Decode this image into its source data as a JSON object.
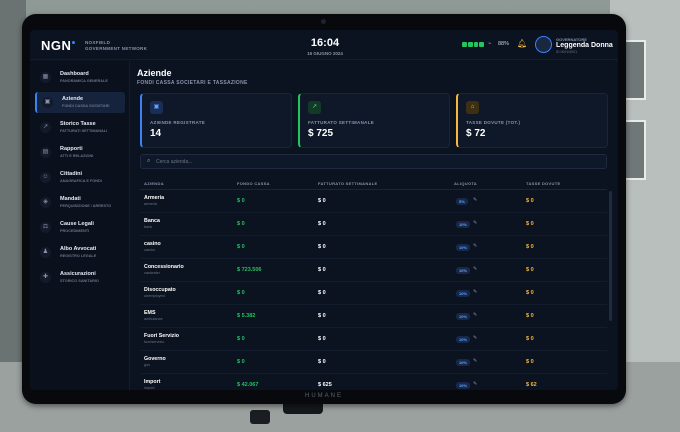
{
  "header": {
    "logo": "NGN",
    "org_line1": "NOXFIELD",
    "org_line2": "GOVERNMENT NETWORK",
    "time": "16:04",
    "date": "16 GIUGNO 2024",
    "battery_pct": "88%",
    "user_role": "GOVERNATORE",
    "user_name": "Leggenda Donna",
    "user_id": "ID 0001/0001"
  },
  "device_label": "HUMANE",
  "sidebar": {
    "items": [
      {
        "label": "Dashboard",
        "sub": "PANORAMICA GENERALE",
        "icon": "dashboard-icon",
        "glyph": "▦"
      },
      {
        "label": "Aziende",
        "sub": "FONDI CASSA SOCIETARI",
        "icon": "building-icon",
        "glyph": "▣"
      },
      {
        "label": "Storico Tasse",
        "sub": "FATTURATI SETTIMANALI",
        "icon": "chart-icon",
        "glyph": "↗"
      },
      {
        "label": "Rapporti",
        "sub": "ATTI E RELAZIONI",
        "icon": "document-icon",
        "glyph": "▤"
      },
      {
        "label": "Cittadini",
        "sub": "ANAGRAFICA E FONDI",
        "icon": "users-icon",
        "glyph": "☺"
      },
      {
        "label": "Mandati",
        "sub": "PERQUISIZIONE / ARRESTO",
        "icon": "shield-icon",
        "glyph": "◈"
      },
      {
        "label": "Cause Legali",
        "sub": "PROCEDIMENTI",
        "icon": "scales-icon",
        "glyph": "⚖"
      },
      {
        "label": "Albo Avvocati",
        "sub": "REGISTRO LEGALE",
        "icon": "lawyer-icon",
        "glyph": "♟"
      },
      {
        "label": "Assicurazioni",
        "sub": "STORICO SANITARIO",
        "icon": "insurance-icon",
        "glyph": "✚"
      }
    ]
  },
  "main": {
    "title": "Aziende",
    "subtitle": "FONDI CASSA SOCIETARI E TASSAZIONE",
    "cards": [
      {
        "label": "AZIENDE REGISTRATE",
        "value": "14",
        "icon": "building-icon",
        "glyph": "▣"
      },
      {
        "label": "FATTURATO SETTIMANALE",
        "value": "$ 725",
        "icon": "trend-icon",
        "glyph": "↗"
      },
      {
        "label": "TASSE DOVUTE (TOT.)",
        "value": "$ 72",
        "icon": "bank-icon",
        "glyph": "⌂"
      }
    ],
    "search_placeholder": "Cerca azienda...",
    "columns": [
      "AZIENDA",
      "FONDO CASSA",
      "FATTURATO SETTIMANALE",
      "ALIQUOTA",
      "TASSE DOVUTE"
    ],
    "rows": [
      {
        "name": "Armeria",
        "sub": "armeria",
        "fondo": "$ 0",
        "fatturato": "$ 0",
        "aliquota": "5%",
        "tasse": "$ 0"
      },
      {
        "name": "Banca",
        "sub": "bank",
        "fondo": "$ 0",
        "fatturato": "$ 0",
        "aliquota": "10%",
        "tasse": "$ 0"
      },
      {
        "name": "casino",
        "sub": "casino",
        "fondo": "$ 0",
        "fatturato": "$ 0",
        "aliquota": "10%",
        "tasse": "$ 0"
      },
      {
        "name": "Concessionario",
        "sub": "cardealer",
        "fondo": "$ 723.506",
        "fatturato": "$ 0",
        "aliquota": "10%",
        "tasse": "$ 0"
      },
      {
        "name": "Disoccupato",
        "sub": "unemployed",
        "fondo": "$ 0",
        "fatturato": "$ 0",
        "aliquota": "10%",
        "tasse": "$ 0"
      },
      {
        "name": "EMS",
        "sub": "ambulance",
        "fondo": "$ 5.382",
        "fatturato": "$ 0",
        "aliquota": "10%",
        "tasse": "$ 0"
      },
      {
        "name": "Fuori Servizio",
        "sub": "fuoriservizio",
        "fondo": "$ 0",
        "fatturato": "$ 0",
        "aliquota": "10%",
        "tasse": "$ 0"
      },
      {
        "name": "Governo",
        "sub": "gov",
        "fondo": "$ 0",
        "fatturato": "$ 0",
        "aliquota": "10%",
        "tasse": "$ 0"
      },
      {
        "name": "Import",
        "sub": "import",
        "fondo": "$ 42.067",
        "fatturato": "$ 625",
        "aliquota": "10%",
        "tasse": "$ 62"
      }
    ]
  },
  "colors": {
    "accent": "#3b82f6",
    "money_green": "#22c55e",
    "tax_gold": "#f5b942",
    "background": "#0b1220"
  }
}
